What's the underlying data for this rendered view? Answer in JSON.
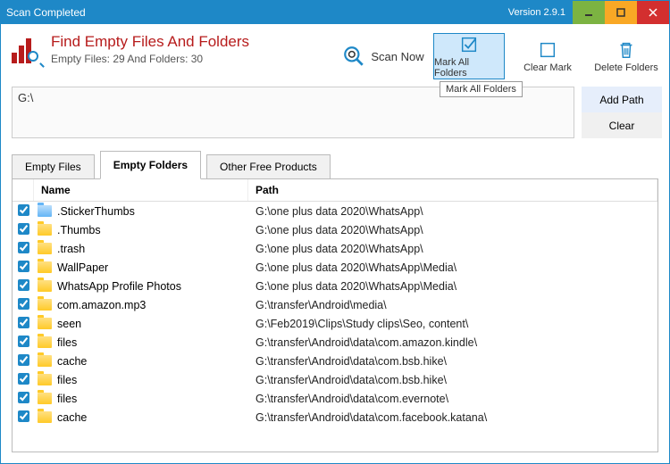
{
  "window": {
    "title": "Scan Completed",
    "version": "Version 2.9.1"
  },
  "header": {
    "app_title": "Find Empty Files And Folders",
    "stats": "Empty Files: 29 And Folders: 30",
    "toolbar": {
      "scan": "Scan Now",
      "mark_all": "Mark All Folders",
      "mark_all_tooltip": "Mark All Folders",
      "clear_mark": "Clear Mark",
      "delete": "Delete Folders"
    }
  },
  "path": {
    "value": "G:\\",
    "add": "Add Path",
    "clear": "Clear"
  },
  "tabs": {
    "empty_files": "Empty Files",
    "empty_folders": "Empty Folders",
    "other": "Other Free Products"
  },
  "columns": {
    "name": "Name",
    "path": "Path"
  },
  "rows": [
    {
      "checked": true,
      "blue": true,
      "name": ".StickerThumbs",
      "path": "G:\\one plus data 2020\\WhatsApp\\"
    },
    {
      "checked": true,
      "blue": false,
      "name": ".Thumbs",
      "path": "G:\\one plus data 2020\\WhatsApp\\"
    },
    {
      "checked": true,
      "blue": false,
      "name": ".trash",
      "path": "G:\\one plus data 2020\\WhatsApp\\"
    },
    {
      "checked": true,
      "blue": false,
      "name": "WallPaper",
      "path": "G:\\one plus data 2020\\WhatsApp\\Media\\"
    },
    {
      "checked": true,
      "blue": false,
      "name": "WhatsApp Profile Photos",
      "path": "G:\\one plus data 2020\\WhatsApp\\Media\\"
    },
    {
      "checked": true,
      "blue": false,
      "name": "com.amazon.mp3",
      "path": "G:\\transfer\\Android\\media\\"
    },
    {
      "checked": true,
      "blue": false,
      "name": "seen",
      "path": "G:\\Feb2019\\Clips\\Study clips\\Seo, content\\"
    },
    {
      "checked": true,
      "blue": false,
      "name": "files",
      "path": "G:\\transfer\\Android\\data\\com.amazon.kindle\\"
    },
    {
      "checked": true,
      "blue": false,
      "name": "cache",
      "path": "G:\\transfer\\Android\\data\\com.bsb.hike\\"
    },
    {
      "checked": true,
      "blue": false,
      "name": "files",
      "path": "G:\\transfer\\Android\\data\\com.bsb.hike\\"
    },
    {
      "checked": true,
      "blue": false,
      "name": "files",
      "path": "G:\\transfer\\Android\\data\\com.evernote\\"
    },
    {
      "checked": true,
      "blue": false,
      "name": "cache",
      "path": "G:\\transfer\\Android\\data\\com.facebook.katana\\"
    }
  ]
}
